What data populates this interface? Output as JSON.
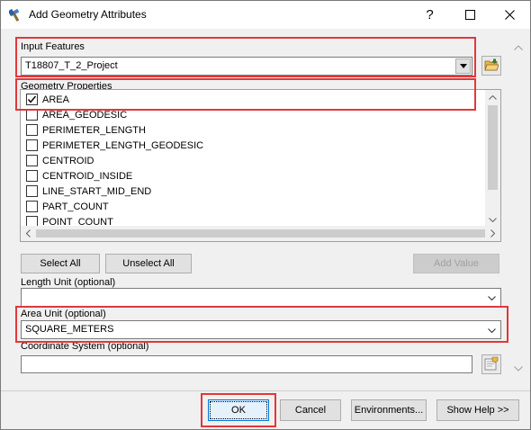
{
  "window": {
    "title": "Add Geometry Attributes",
    "icon": "arctoolbox-hammer-icon"
  },
  "titlebar_buttons": {
    "help": "?",
    "minimize": "minimize-icon",
    "maximize": "maximize-icon",
    "close": "close-icon"
  },
  "input_features": {
    "label": "Input Features",
    "value": "T18807_T_2_Project"
  },
  "geometry_properties": {
    "label": "Geometry Properties",
    "items": [
      {
        "label": "AREA",
        "checked": true
      },
      {
        "label": "AREA_GEODESIC",
        "checked": false
      },
      {
        "label": "PERIMETER_LENGTH",
        "checked": false
      },
      {
        "label": "PERIMETER_LENGTH_GEODESIC",
        "checked": false
      },
      {
        "label": "CENTROID",
        "checked": false
      },
      {
        "label": "CENTROID_INSIDE",
        "checked": false
      },
      {
        "label": "LINE_START_MID_END",
        "checked": false
      },
      {
        "label": "PART_COUNT",
        "checked": false
      },
      {
        "label": "POINT_COUNT",
        "checked": false
      }
    ]
  },
  "list_buttons": {
    "select_all": "Select All",
    "unselect_all": "Unselect All",
    "add_value": "Add Value"
  },
  "length_unit": {
    "label": "Length Unit (optional)",
    "value": ""
  },
  "area_unit": {
    "label": "Area Unit (optional)",
    "value": "SQUARE_METERS"
  },
  "coordinate_system": {
    "label": "Coordinate System (optional)",
    "value": ""
  },
  "footer": {
    "ok": "OK",
    "cancel": "Cancel",
    "environments": "Environments...",
    "show_help": "Show Help >>"
  },
  "colors": {
    "highlight_box": "#e0383b",
    "dialog_bg": "#f0f0f0",
    "ok_border": "#0078d7"
  }
}
